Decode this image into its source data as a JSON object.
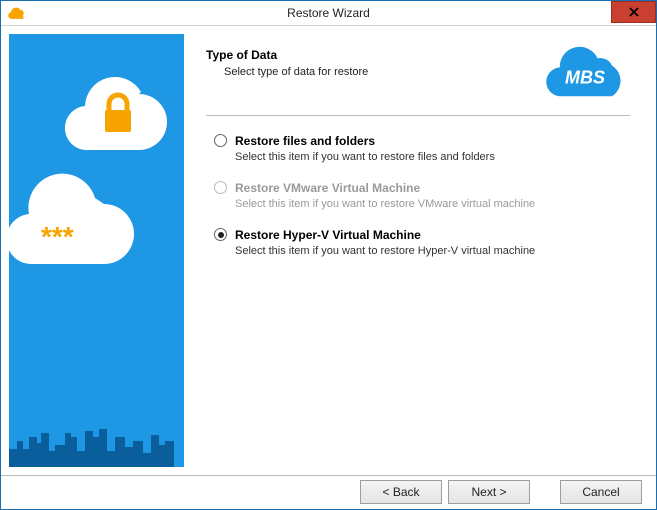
{
  "window": {
    "title": "Restore Wizard"
  },
  "brand": {
    "text": "MBS"
  },
  "header": {
    "title": "Type of Data",
    "subtitle": "Select type of data for restore"
  },
  "options": [
    {
      "label": "Restore files and folders",
      "desc": "Select this item if you want to restore files and folders",
      "selected": false,
      "enabled": true
    },
    {
      "label": "Restore VMware Virtual Machine",
      "desc": "Select this item if you want to restore VMware virtual machine",
      "selected": false,
      "enabled": false
    },
    {
      "label": "Restore Hyper-V Virtual Machine",
      "desc": "Select this item if you want to restore Hyper-V virtual machine",
      "selected": true,
      "enabled": true
    }
  ],
  "footer": {
    "back": "< Back",
    "next": "Next >",
    "cancel": "Cancel"
  }
}
